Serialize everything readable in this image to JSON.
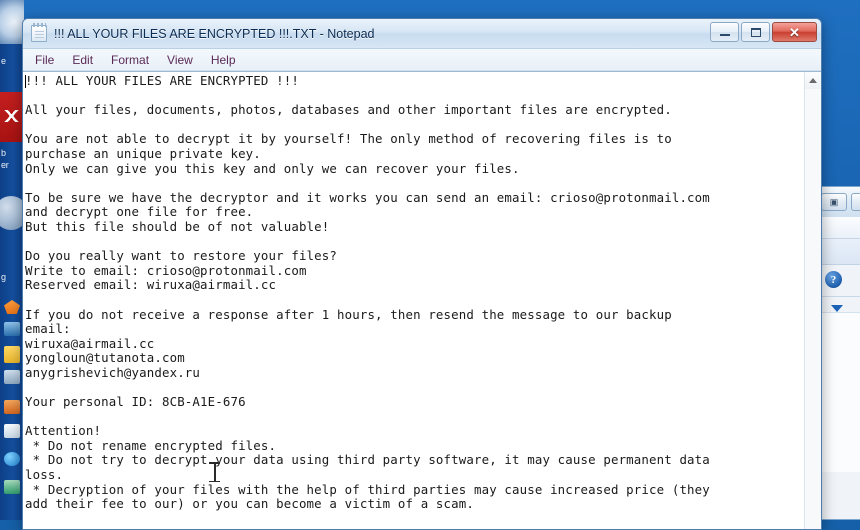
{
  "window": {
    "title": "!!! ALL YOUR FILES ARE ENCRYPTED !!!.TXT - Notepad",
    "app_icon": "notepad-icon",
    "controls": {
      "minimize": "—",
      "maximize": "□",
      "close": "✕"
    },
    "menu": [
      {
        "label": "File"
      },
      {
        "label": "Edit"
      },
      {
        "label": "Format"
      },
      {
        "label": "View"
      },
      {
        "label": "Help"
      }
    ]
  },
  "document": {
    "content": "!!! ALL YOUR FILES ARE ENCRYPTED !!!\n\nAll your files, documents, photos, databases and other important files are encrypted.\n\nYou are not able to decrypt it by yourself! The only method of recovering files is to\npurchase an unique private key.\nOnly we can give you this key and only we can recover your files.\n\nTo be sure we have the decryptor and it works you can send an email: crioso@protonmail.com\nand decrypt one file for free.\nBut this file should be of not valuable!\n\nDo you really want to restore your files?\nWrite to email: crioso@protonmail.com\nReserved email: wiruxa@airmail.cc\n\nIf you do not receive a response after 1 hours, then resend the message to our backup\nemail:\nwiruxa@airmail.cc\nyongloun@tutanota.com\nanygrishevich@yandex.ru\n\nYour personal ID: 8CB-A1E-676\n\nAttention!\n * Do not rename encrypted files.\n * Do not try to decrypt your data using third party software, it may cause permanent data\nloss.\n * Decryption of your files with the help of third parties may cause increased price (they\nadd their fee to our) or you can become a victim of a scam.",
    "personal_id": "8CB-A1E-676",
    "contact_emails": [
      "crioso@protonmail.com",
      "wiruxa@airmail.cc",
      "yongloun@tutanota.com",
      "anygrishevich@yandex.ru"
    ]
  },
  "scrollbar": {
    "up_arrow": "▲"
  },
  "desktop": {
    "taskbar_labels": [
      "e",
      "b",
      "er",
      "g"
    ],
    "background_color": "#1863b0"
  },
  "background_window": {
    "help_glyph": "?",
    "dropdown_glyph": "▼",
    "button_glyphs": [
      "▣",
      "✕"
    ]
  }
}
